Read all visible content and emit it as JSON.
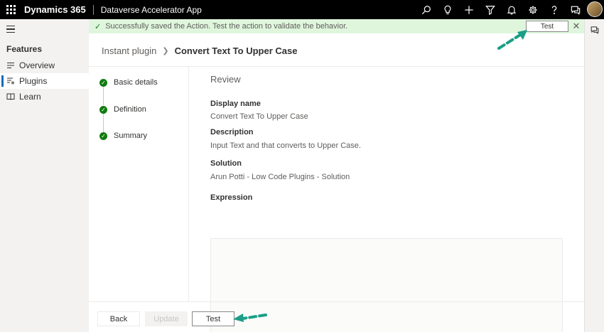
{
  "topbar": {
    "brand": "Dynamics 365",
    "app_name": "Dataverse Accelerator App",
    "icons": [
      "search-icon",
      "lightbulb-icon",
      "plus-icon",
      "filter-icon",
      "bell-icon",
      "gear-icon",
      "help-icon",
      "chat-icon"
    ]
  },
  "sidebar": {
    "section": "Features",
    "items": [
      {
        "label": "Overview",
        "icon": "overview-icon"
      },
      {
        "label": "Plugins",
        "icon": "plugins-icon",
        "active": true
      },
      {
        "label": "Learn",
        "icon": "book-icon"
      }
    ]
  },
  "notification": {
    "message": "Successfully saved the Action. Test the action to validate the behavior.",
    "action_label": "Test",
    "status_color": "#107c10",
    "background_color": "#dff6dd"
  },
  "breadcrumb": {
    "root": "Instant plugin",
    "current": "Convert Text To Upper Case"
  },
  "steps": [
    {
      "label": "Basic details"
    },
    {
      "label": "Definition"
    },
    {
      "label": "Summary"
    }
  ],
  "review": {
    "title": "Review",
    "display_name_label": "Display name",
    "display_name_value": "Convert Text To Upper Case",
    "description_label": "Description",
    "description_value": "Input Text and that converts to Upper Case.",
    "solution_label": "Solution",
    "solution_value": "Arun Potti - Low Code Plugins - Solution",
    "expression_label": "Expression",
    "expression_value": ""
  },
  "footer": {
    "back_label": "Back",
    "update_label": "Update",
    "test_label": "Test"
  },
  "annotation_color": "#1a9e86"
}
